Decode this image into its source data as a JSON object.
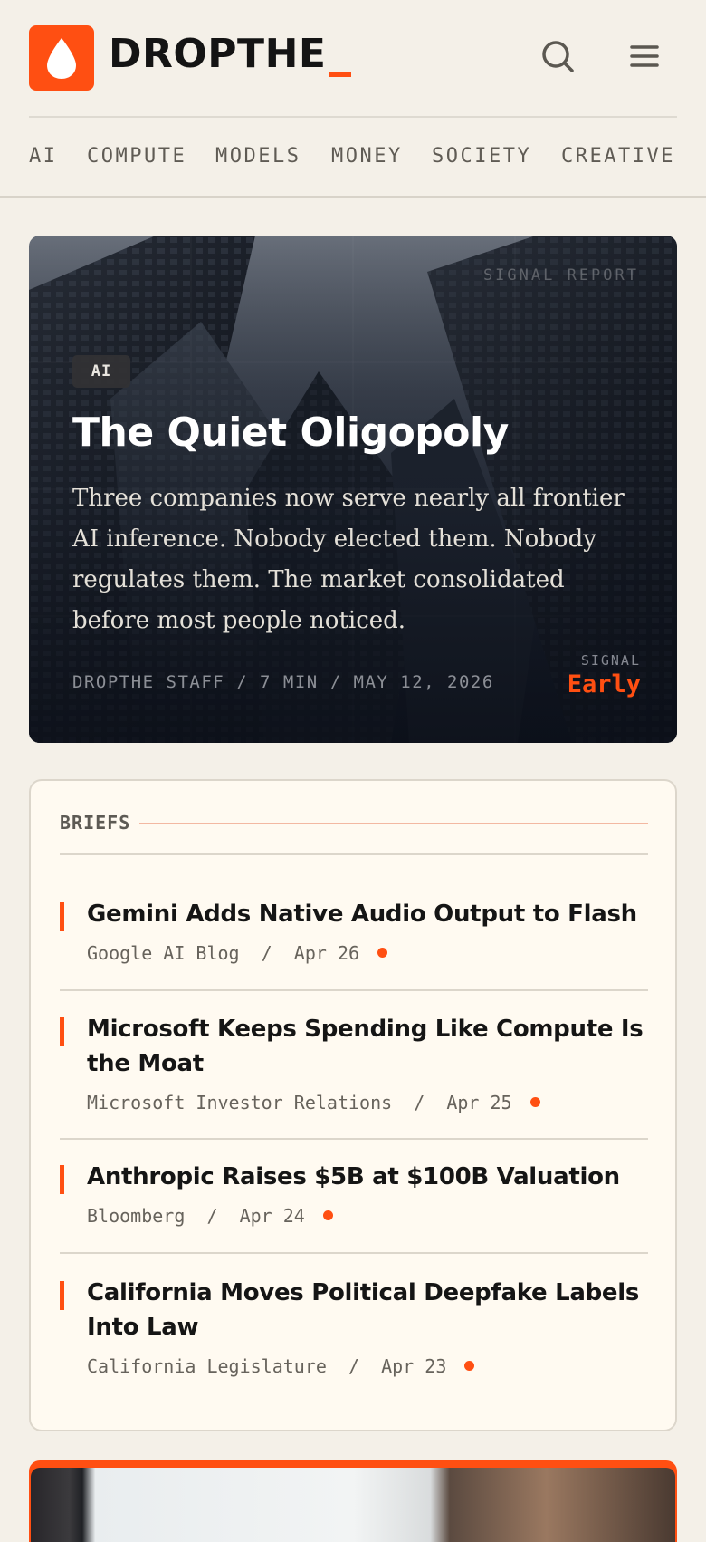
{
  "header": {
    "brand": "DROPTHE",
    "cursor": "_"
  },
  "nav": {
    "items": [
      "AI",
      "COMPUTE",
      "MODELS",
      "MONEY",
      "SOCIETY",
      "CREATIVE"
    ]
  },
  "hero": {
    "kicker": "SIGNAL REPORT",
    "tag": "AI",
    "title": "The Quiet Oligopoly",
    "dek": "Three companies now serve nearly all frontier AI inference. Nobody elected them. Nobody regulates them. The market consolidated before most people noticed.",
    "meta": "DROPTHE STAFF  /  7 MIN  /  MAY 12, 2026",
    "signal_label": "SIGNAL",
    "signal_value": "Early"
  },
  "briefs": {
    "heading": "BRIEFS",
    "items": [
      {
        "title": "Gemini Adds Native Audio Output to Flash",
        "meta": "Google AI Blog  /  Apr 26"
      },
      {
        "title": "Microsoft Keeps Spending Like Compute Is the Moat",
        "meta": "Microsoft Investor Relations  /  Apr 25"
      },
      {
        "title": "Anthropic Raises $5B at $100B Valuation",
        "meta": "Bloomberg  /  Apr 24"
      },
      {
        "title": "California Moves Political Deepfake Labels Into Law",
        "meta": "California Legislature  /  Apr 23"
      }
    ]
  },
  "colors": {
    "accent": "#ff4f12",
    "background": "#f4f0e8",
    "card": "#fffaf1"
  },
  "icons": [
    "drop-logo-icon",
    "search-icon",
    "menu-icon",
    "status-dot-icon"
  ]
}
